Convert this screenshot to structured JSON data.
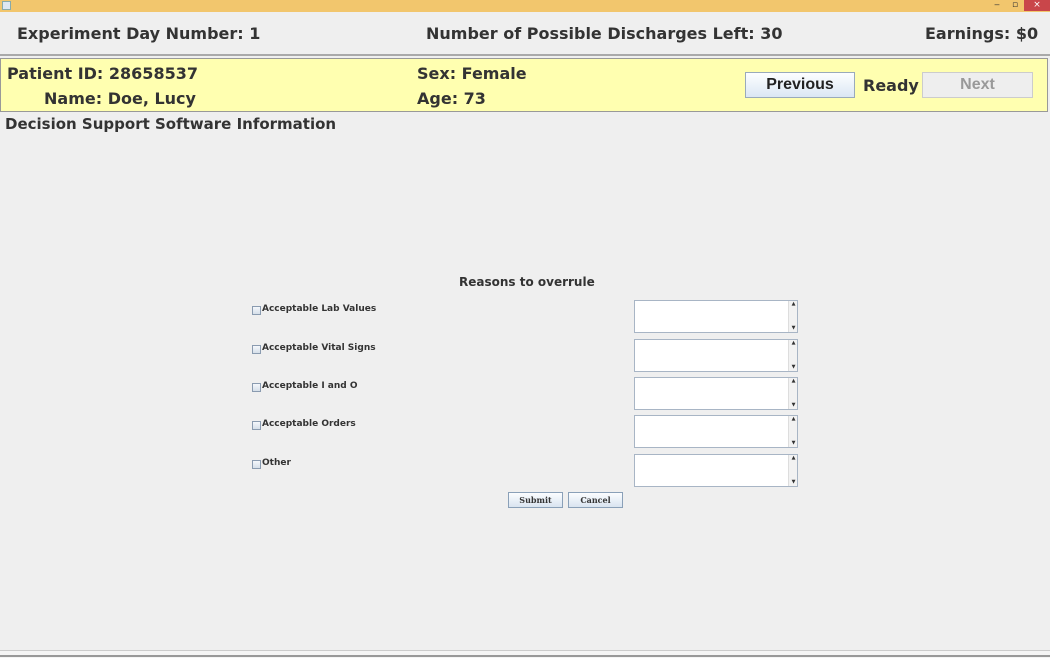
{
  "window": {
    "minimize_glyph": "‒",
    "maximize_glyph": "▫",
    "close_glyph": "×"
  },
  "header": {
    "day_label": "Experiment Day Number:",
    "day_value": "1",
    "discharges_label": "Number of Possible Discharges Left:",
    "discharges_value": "30",
    "earnings_label": "Earnings:",
    "earnings_value": "$0"
  },
  "patient": {
    "id_label": "Patient ID:",
    "id_value": "28658537",
    "name_label": "Name:",
    "name_value": "Doe, Lucy",
    "sex_label": "Sex:",
    "sex_value": "Female",
    "age_label": "Age:",
    "age_value": "73"
  },
  "nav": {
    "previous_label": "Previous",
    "status_label": "Ready",
    "next_label": "Next"
  },
  "section_title": "Decision Support Software Information",
  "form": {
    "title": "Reasons to overrule",
    "reasons": [
      {
        "label": "Acceptable Lab Values",
        "checked": false,
        "text": ""
      },
      {
        "label": "Acceptable Vital Signs",
        "checked": false,
        "text": ""
      },
      {
        "label": "Acceptable I and O",
        "checked": false,
        "text": ""
      },
      {
        "label": "Acceptable Orders",
        "checked": false,
        "text": ""
      },
      {
        "label": "Other",
        "checked": false,
        "text": ""
      }
    ],
    "submit_label": "Submit",
    "cancel_label": "Cancel"
  }
}
